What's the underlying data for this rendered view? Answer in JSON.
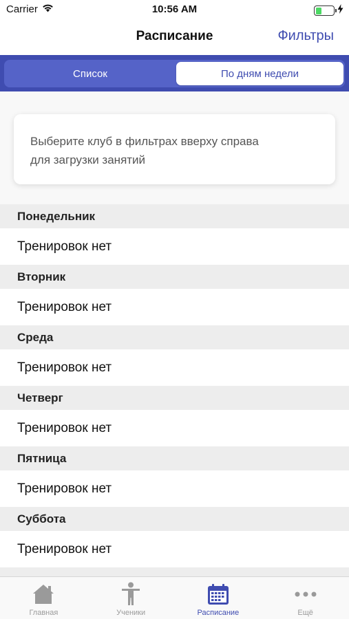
{
  "status_bar": {
    "carrier": "Carrier",
    "time": "10:56 AM",
    "battery_level": 0.35
  },
  "nav": {
    "title": "Расписание",
    "filters_label": "Фильтры"
  },
  "segments": {
    "list_label": "Список",
    "by_days_label": "По дням недели",
    "selected": "by_days"
  },
  "info_message": {
    "line1": "Выберите клуб в фильтрах вверху справа",
    "line2": "для загрузки занятий"
  },
  "days": [
    {
      "name": "Понедельник",
      "status": "Тренировок нет"
    },
    {
      "name": "Вторник",
      "status": "Тренировок нет"
    },
    {
      "name": "Среда",
      "status": "Тренировок нет"
    },
    {
      "name": "Четверг",
      "status": "Тренировок нет"
    },
    {
      "name": "Пятница",
      "status": "Тренировок нет"
    },
    {
      "name": "Суббота",
      "status": "Тренировок нет"
    }
  ],
  "tab_bar": {
    "items": [
      {
        "label": "Главная",
        "icon": "home-icon"
      },
      {
        "label": "Ученики",
        "icon": "person-icon"
      },
      {
        "label": "Расписание",
        "icon": "calendar-icon"
      },
      {
        "label": "Ещё",
        "icon": "more-icon"
      }
    ],
    "active": "Расписание"
  },
  "colors": {
    "accent": "#3f4cb0",
    "segment_bg": "#5563c8",
    "section_header_bg": "#ededed",
    "inactive_tab": "#9a9a9a"
  }
}
